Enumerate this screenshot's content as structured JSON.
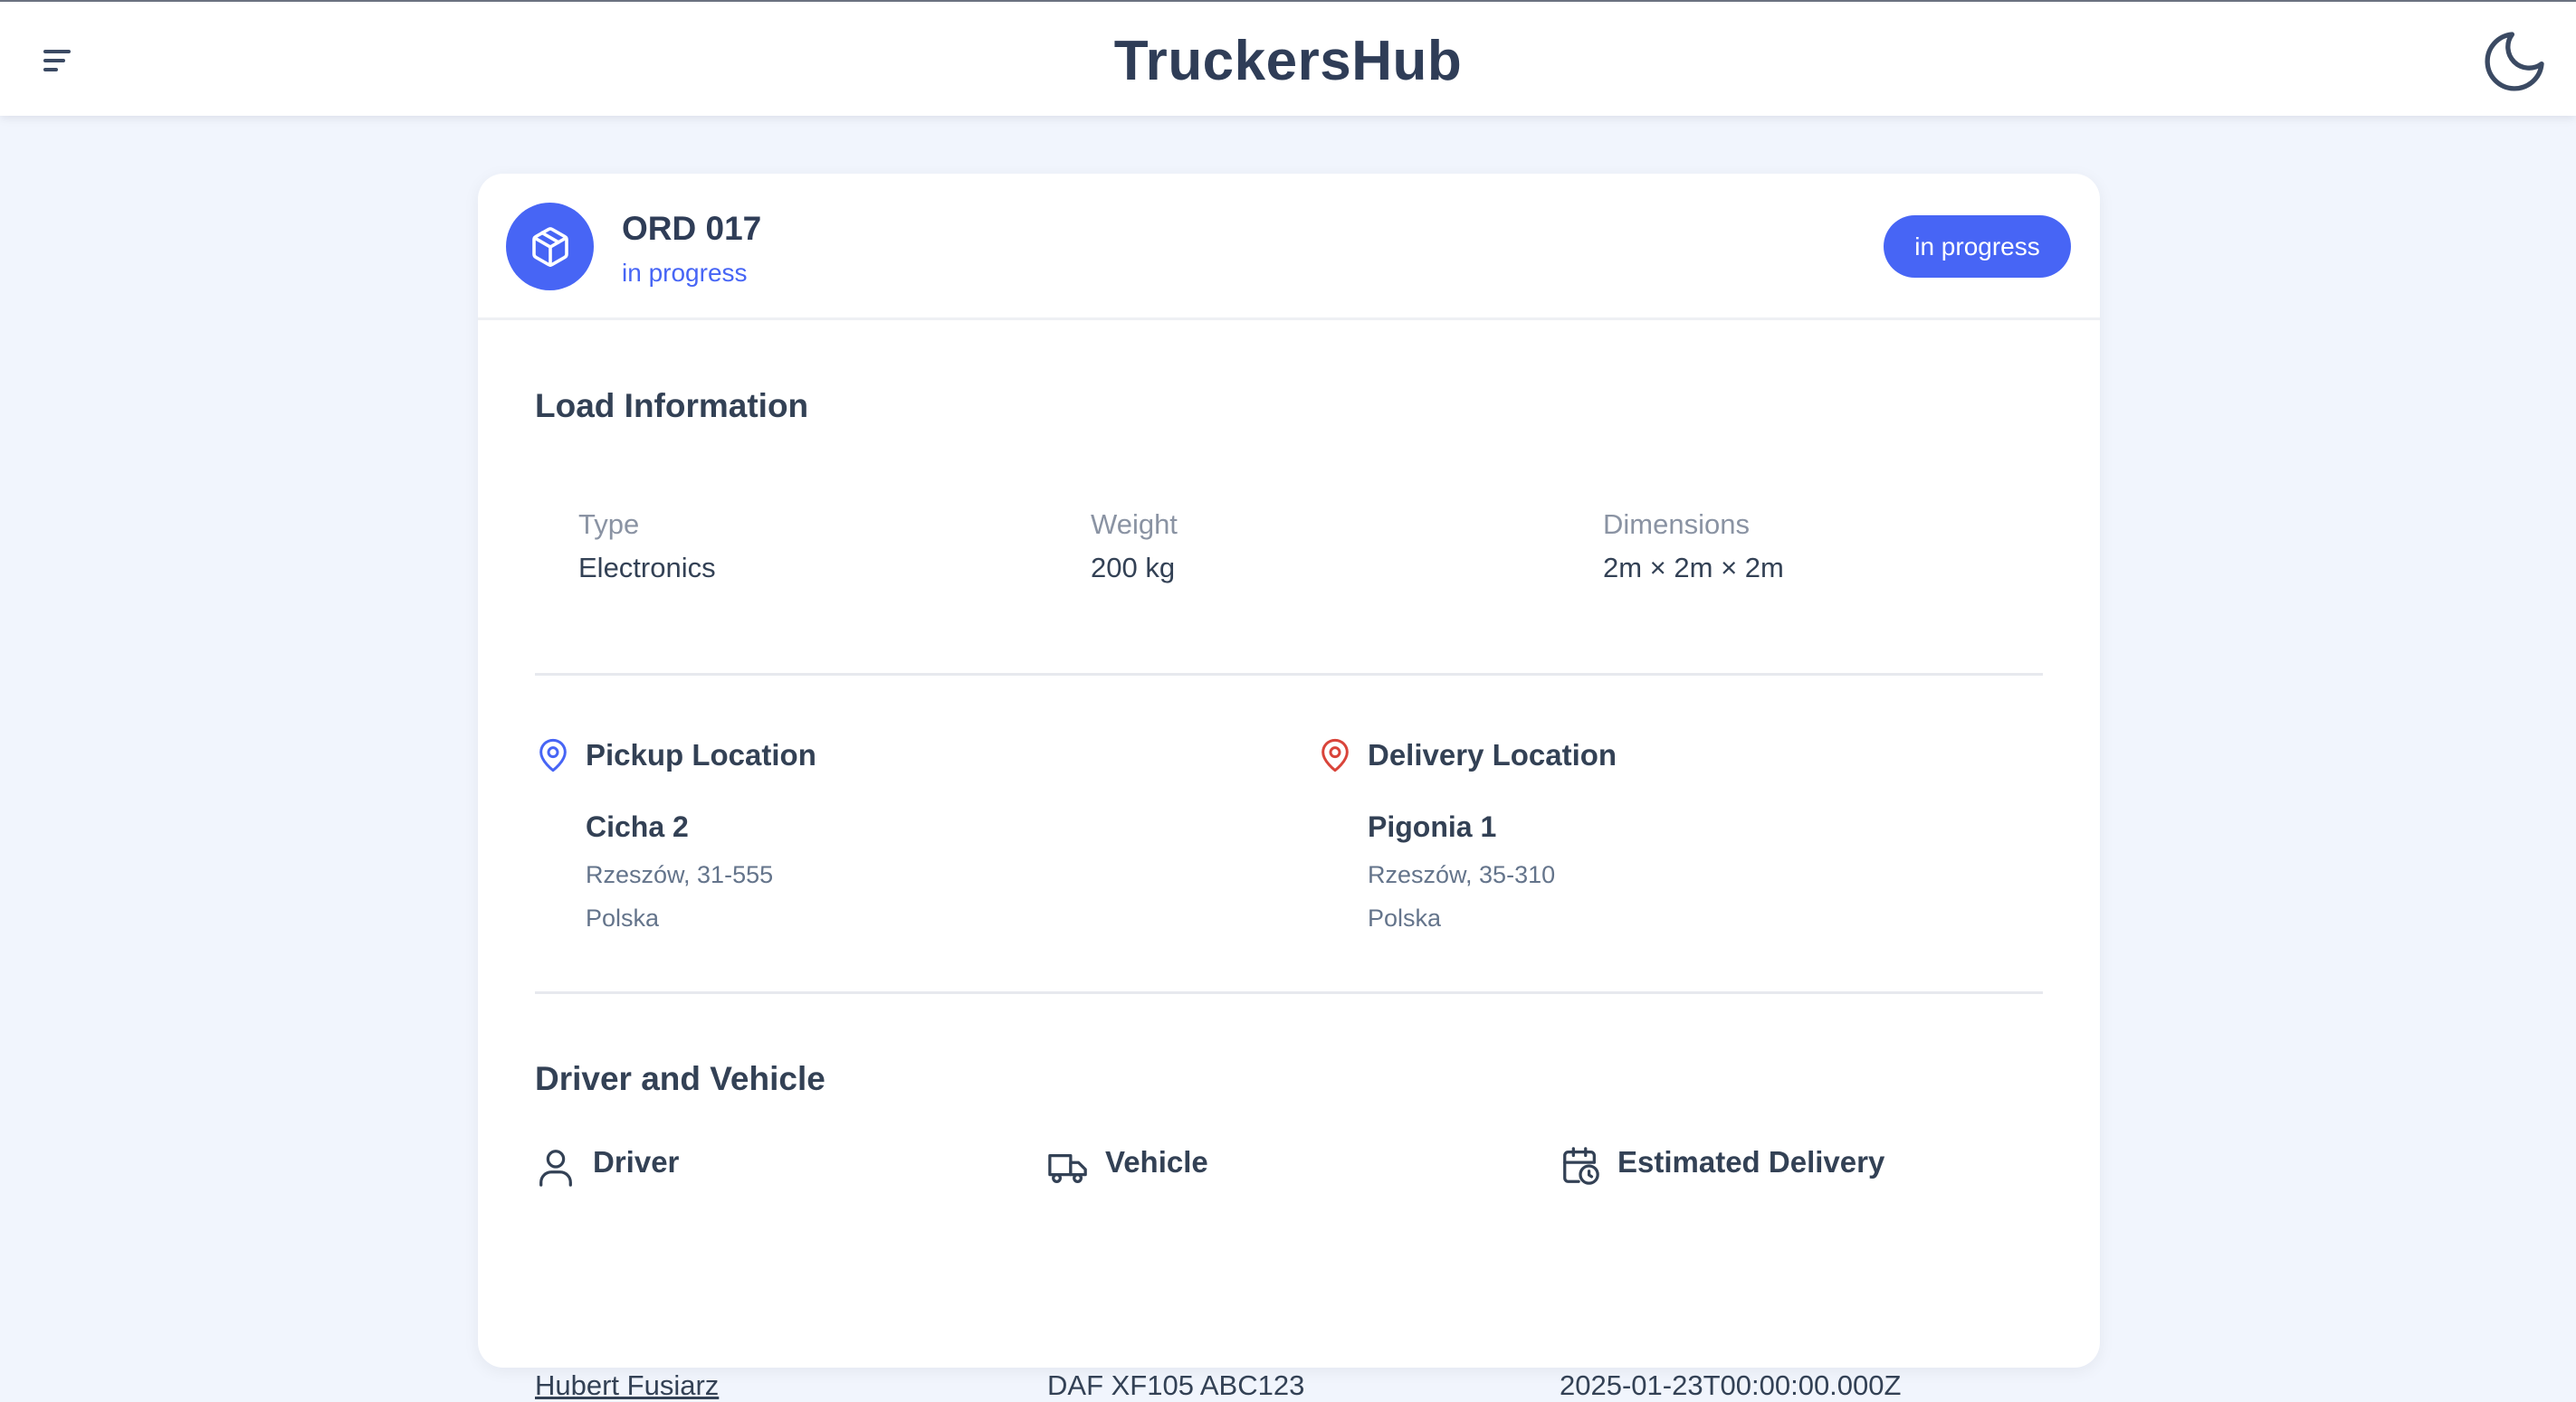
{
  "header": {
    "brand": "TruckersHub",
    "menu_icon": "hamburger-menu-icon",
    "theme_icon": "moon-icon"
  },
  "order": {
    "id": "ORD 017",
    "status": "in progress",
    "status_badge": "in progress",
    "icon": "package-icon",
    "accent_color": "#4765f5"
  },
  "load": {
    "title": "Load Information",
    "fields": [
      {
        "label": "Type",
        "value": "Electronics"
      },
      {
        "label": "Weight",
        "value": "200 kg"
      },
      {
        "label": "Dimensions",
        "value": "2m × 2m × 2m"
      }
    ]
  },
  "pickup": {
    "heading": "Pickup Location",
    "street": "Cicha 2",
    "city": "Rzeszów, 31-555",
    "country": "Polska",
    "icon": "map-pin-icon",
    "icon_color": "#4765f5"
  },
  "delivery": {
    "heading": "Delivery Location",
    "street": "Pigonia 1",
    "city": "Rzeszów, 35-310",
    "country": "Polska",
    "icon": "map-pin-icon",
    "icon_color": "#d9443a"
  },
  "driver_vehicle": {
    "title": "Driver and Vehicle",
    "driver_label": "Driver",
    "driver_name": "Hubert Fusiarz",
    "vehicle_label": "Vehicle",
    "vehicle_value": "DAF XF105 ABC123",
    "eta_label": "Estimated Delivery",
    "eta_value": "2025-01-23T00:00:00.000Z"
  }
}
